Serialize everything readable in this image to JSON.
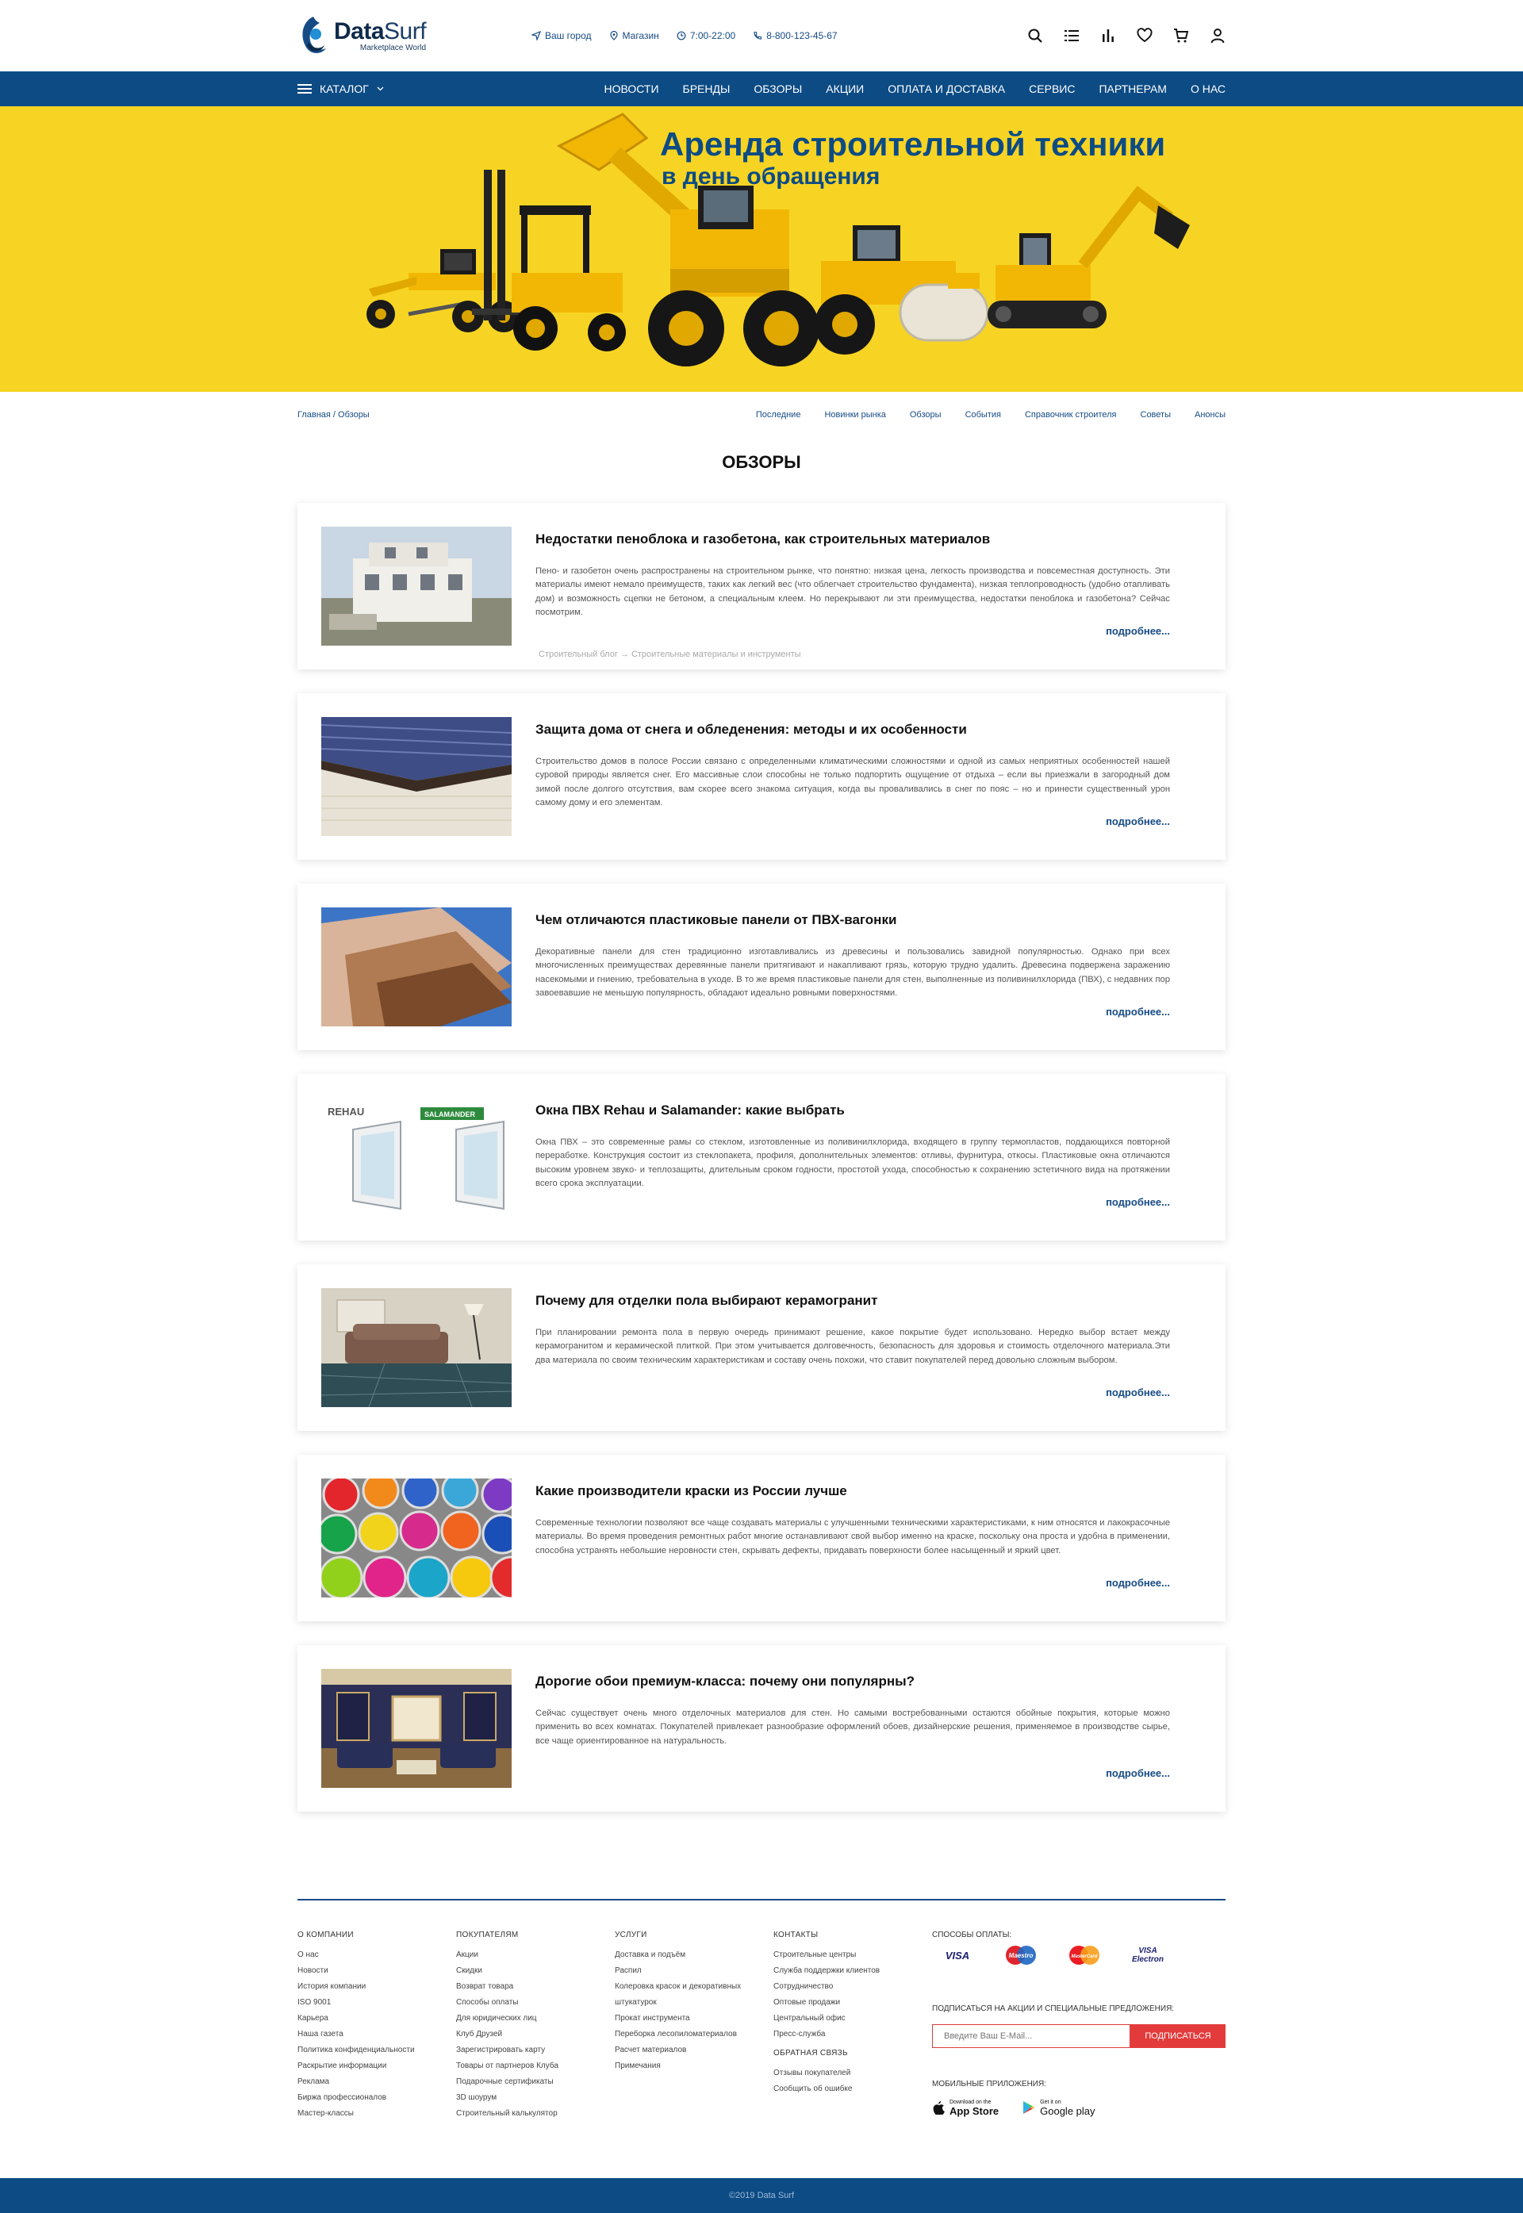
{
  "header": {
    "logo_name_a": "Data",
    "logo_name_b": "Surf",
    "logo_tagline": "Marketplace World",
    "city": "Ваш город",
    "store": "Магазин",
    "hours": "7:00-22:00",
    "phone": "8-800-123-45-67",
    "icons": [
      "search-icon",
      "compare-list-icon",
      "stats-icon",
      "heart-icon",
      "cart-icon",
      "user-icon"
    ]
  },
  "nav": {
    "catalog_label": "КАТАЛОГ",
    "links": [
      "НОВОСТИ",
      "БРЕНДЫ",
      "ОБЗОРЫ",
      "АКЦИИ",
      "ОПЛАТА И ДОСТАВКА",
      "СЕРВИС",
      "ПАРТНЕРАМ",
      "О НАС"
    ]
  },
  "banner": {
    "title": "Аренда строительной техники",
    "subtitle": "в день обращения",
    "background": "#f7d423",
    "text_color": "#0c4b84"
  },
  "breadcrumb": "Главная / Обзоры",
  "subnav": [
    "Последние",
    "Новинки рынка",
    "Обзоры",
    "События",
    "Справочник строителя",
    "Советы",
    "Анонсы"
  ],
  "page_title": "ОБЗОРЫ",
  "more_label": "подробнее...",
  "articles": [
    {
      "title": "Недостатки пеноблока и газобетона, как строительных материалов",
      "text": "Пено- и газобетон очень распространены на строительном рынке, что понятно: низкая цена, легкость производства и повсеместная доступность. Эти материалы имеют немало преимуществ, таких как легкий вес (что облегчает строительство фундамента), низкая теплопроводность (удобно отапливать дом) и возможность сцепки не бетоном, а специальным клеем. Но перекрывают ли эти преимущества, недостатки пеноблока и газобетона? Сейчас посмотрим.",
      "tags": "Строительный блог → Строительные материалы и инструменты"
    },
    {
      "title": "Защита дома от снега и обледенения: методы и их особенности",
      "text": "Строительство домов в полосе России связано с определенными климатическими сложностями и одной из самых неприятных особенностей нашей суровой природы является снег. Его массивные слои способны не только подпортить ощущение от отдыха – если вы приезжали в загородный дом зимой после долгого отсутствия, вам скорее всего знакома ситуация, когда вы проваливались в снег по пояс – но и принести существенный урон самому дому и его элементам.",
      "tags": ""
    },
    {
      "title": "Чем отличаются пластиковые панели от ПВХ-вагонки",
      "text": "Декоративные панели для стен традиционно изготавливались из древесины и пользовались завидной популярностью. Однако при всех многочисленных преимуществах деревянные панели притягивают и накапливают грязь, которую трудно удалить. Древесина подвержена заражению насекомыми и гниению, требовательна в уходе. В то же время пластиковые панели для стен, выполненные из поливинилхлорида (ПВХ), с недавних пор завоевавшие не меньшую популярность, обладают идеально ровными поверхностями.",
      "tags": ""
    },
    {
      "title": "Окна ПВХ Rehau и Salamander: какие выбрать",
      "text": "Окна ПВХ – это современные рамы со стеклом, изготовленные из поливинилхлорида, входящего в группу термопластов, поддающихся повторной переработке. Конструкция состоит из стеклопакета, профиля, дополнительных элементов: отливы, фурнитура, откосы. Пластиковые окна отличаются высоким уровнем звуко- и теплозащиты, длительным сроком годности, простотой ухода, способностью к сохранению эстетичного вида на протяжении всего срока эксплуатации.",
      "tags": ""
    },
    {
      "title": "Почему для отделки пола выбирают керамогранит",
      "text": "При планировании ремонта пола в первую очередь принимают решение, какое покрытие будет использовано. Нередко выбор встает между керамогранитом и керамической плиткой. При этом учитывается долговечность, безопасность для здоровья и стоимость отделочного материала.Эти два материала по своим техническим характеристикам и составу очень похожи, что ставит покупателей перед довольно сложным выбором.",
      "tags": ""
    },
    {
      "title": "Какие производители краски из России лучше",
      "text": "Современные технологии позволяют все чаще создавать материалы с улучшенными техническими характеристиками, к ним относятся и лакокрасочные материалы. Во время проведения ремонтных работ многие останавливают свой выбор именно на краске, поскольку она проста и удобна в применении, способна устранять небольшие неровности стен, скрывать дефекты, придавать поверхности более насыщенный и яркий цвет.",
      "tags": ""
    },
    {
      "title": "Дорогие обои премиум-класса: почему они популярны?",
      "text": "Сейчас существует очень много отделочных материалов для стен. Но самыми востребованными остаются обойные покрытия, которые можно применить во всех комнатах. Покупателей привлекает разнообразие оформлений обоев, дизайнерские решения, применяемое в производстве сырье, все чаще ориентированное на натуральность.",
      "tags": ""
    }
  ],
  "thumb_logos": {
    "rehau": "REHAU",
    "salamander": "SALAMANDER"
  },
  "footer": {
    "cols": [
      {
        "title": "О КОМПАНИИ",
        "links": [
          "О нас",
          "Новости",
          "История компании",
          "ISO 9001",
          "Карьера",
          "Наша газета",
          "Политика конфиденциальности",
          "Раскрытие информации",
          "Реклама",
          "Биржа профессионалов",
          "Мастер-классы"
        ]
      },
      {
        "title": "ПОКУПАТЕЛЯМ",
        "links": [
          "Акции",
          "Скидки",
          "Возврат товара",
          "Способы оплаты",
          "Для юридических лиц",
          "Клуб Друзей",
          "Зарегистрировать карту",
          "Товары от партнеров Клуба",
          "Подарочные сертификаты",
          "3D шоурум",
          "Строительный калькулятор"
        ]
      },
      {
        "title": "УСЛУГИ",
        "links": [
          "Доставка и подъём",
          "Распил",
          "Колеровка красок и декоративных",
          "штукатурок",
          "Прокат инструмента",
          "Переборка лесопиломатериалов",
          "Расчет материалов",
          "Примечания"
        ]
      },
      {
        "title": "КОНТАКТЫ",
        "links": [
          "Строительные центры",
          "Служба поддержки клиентов",
          "Сотрудничество",
          "Оптовые продажи",
          "Центральный офис",
          "Пресс-служба"
        ],
        "title2": "ОБРАТНАЯ СВЯЗЬ",
        "links2": [
          "Отзывы покупателей",
          "Сообщить об ошибке"
        ]
      }
    ],
    "payment_title": "СПОСОБЫ ОПЛАТЫ:",
    "payments": [
      "VISA",
      "Maestro",
      "MasterCard",
      "VISA Electron"
    ],
    "subscribe_title": "ПОДПИСАТЬСЯ НА АКЦИИ И СПЕЦИАЛЬНЫЕ ПРЕДЛОЖЕНИЯ:",
    "email_placeholder": "Введите Ваш E-Mail...",
    "subscribe_button": "ПОДПИСАТЬСЯ",
    "apps_title": "МОБИЛЬНЫЕ ПРИЛОЖЕНИЯ:",
    "appstore_small": "Download on the",
    "appstore_big": "App Store",
    "gplay_small": "Get it on",
    "gplay_big": "Google play"
  },
  "copyright": "©2019 Data Surf",
  "colors": {
    "primary": "#0c4b84",
    "accent": "#e33b3b",
    "banner": "#f7d423"
  }
}
